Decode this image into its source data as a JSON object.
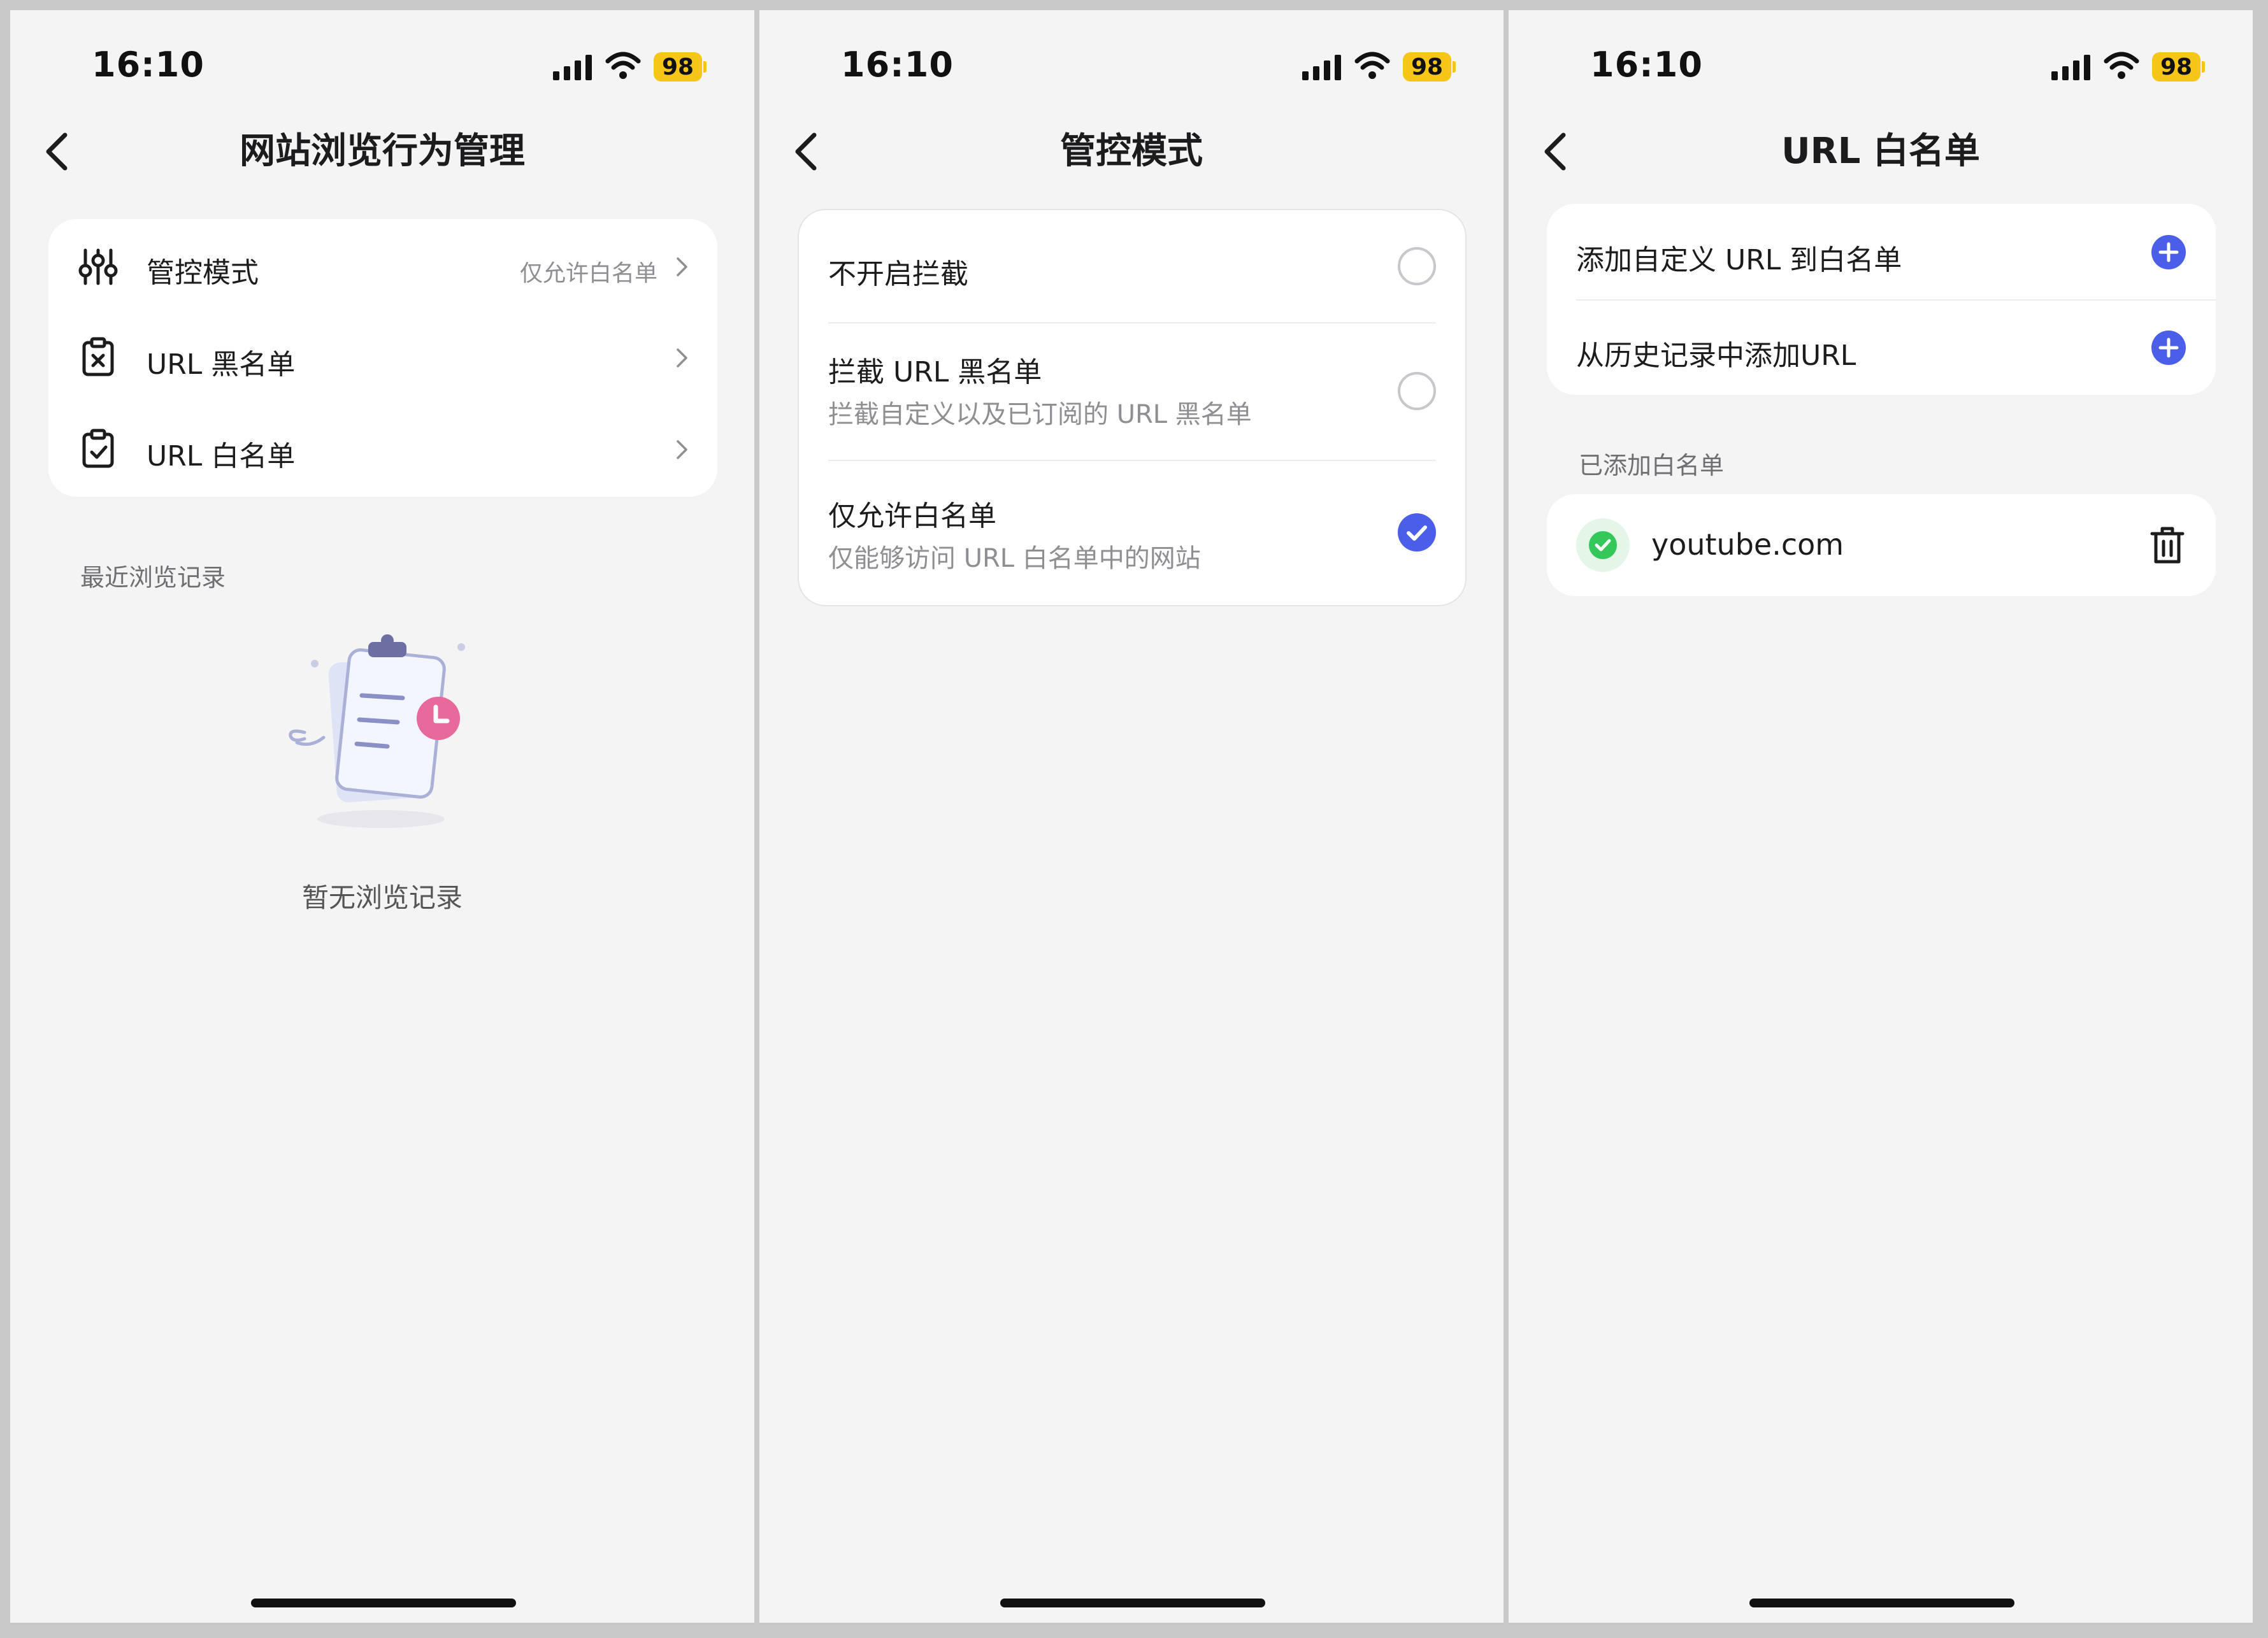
{
  "status_bar": {
    "time": "16:10",
    "battery": "98"
  },
  "colors": {
    "accent": "#4a5ee8",
    "success": "#34c759",
    "battery": "#f5c518",
    "pink": "#e86a9c"
  },
  "screen1": {
    "title": "网站浏览行为管理",
    "menu": [
      {
        "icon": "sliders-icon",
        "label": "管控模式",
        "value": "仅允许白名单"
      },
      {
        "icon": "clipboard-x-icon",
        "label": "URL 黑名单",
        "value": ""
      },
      {
        "icon": "clipboard-check-icon",
        "label": "URL 白名单",
        "value": ""
      }
    ],
    "history_section": "最近浏览记录",
    "empty_text": "暂无浏览记录"
  },
  "screen2": {
    "title": "管控模式",
    "options": [
      {
        "title": "不开启拦截",
        "subtitle": "",
        "selected": false
      },
      {
        "title": "拦截 URL 黑名单",
        "subtitle": "拦截自定义以及已订阅的 URL 黑名单",
        "selected": false
      },
      {
        "title": "仅允许白名单",
        "subtitle": "仅能够访问 URL 白名单中的网站",
        "selected": true
      }
    ]
  },
  "screen3": {
    "title": "URL 白名单",
    "actions": [
      {
        "label": "添加自定义 URL 到白名单",
        "icon": "plus-circle-icon"
      },
      {
        "label": "从历史记录中添加URL",
        "icon": "plus-circle-icon"
      }
    ],
    "added_section": "已添加白名单",
    "whitelist": [
      {
        "domain": "youtube.com",
        "icon": "check-circle-icon"
      }
    ]
  }
}
